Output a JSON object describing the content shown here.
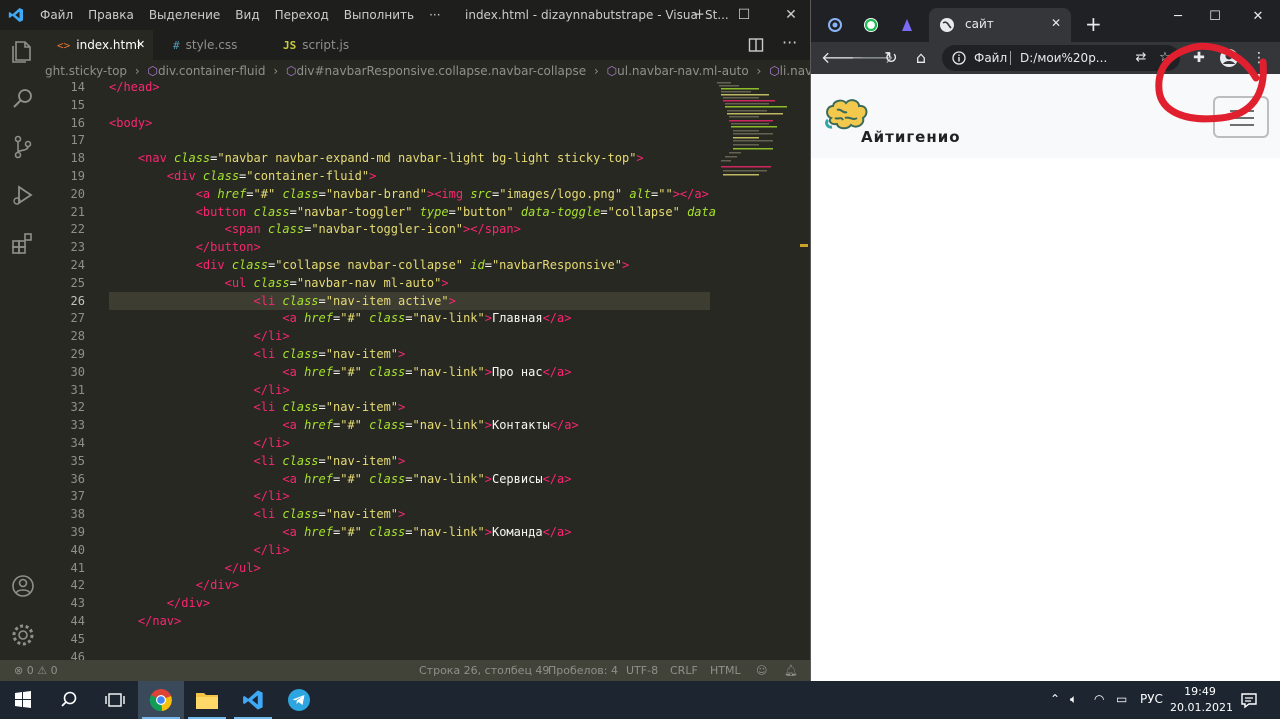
{
  "vscode": {
    "menu": [
      "Файл",
      "Правка",
      "Выделение",
      "Вид",
      "Переход",
      "Выполнить",
      "···"
    ],
    "window_title": "index.html - dizaynnabutstrape - Visual St...",
    "tabs": [
      {
        "icon": "<>",
        "label": "index.html",
        "active": true,
        "close": "✕"
      },
      {
        "icon": "#",
        "label": "style.css",
        "active": false
      },
      {
        "icon": "JS",
        "label": "script.js",
        "active": false
      }
    ],
    "breadcrumb": [
      "ght.sticky-top",
      "div.container-fluid",
      "div#navbarResponsive.collapse.navbar-collapse",
      "ul.navbar-nav.ml-auto",
      "li.nav-item.activ"
    ],
    "current_line": 26,
    "lines": [
      {
        "n": "14",
        "c": [
          [
            "</",
            "t"
          ],
          [
            "head",
            "t"
          ],
          [
            ">",
            "t"
          ]
        ]
      },
      {
        "n": "15",
        "c": []
      },
      {
        "n": "16",
        "c": [
          [
            "<body>",
            "t"
          ]
        ]
      },
      {
        "n": "17",
        "c": []
      },
      {
        "n": "18",
        "c": [
          [
            "    ",
            "p"
          ],
          [
            "<nav ",
            "t"
          ],
          [
            "class",
            "a"
          ],
          [
            "=",
            "p"
          ],
          [
            "\"navbar navbar-expand-md navbar-light bg-light sticky-top\"",
            "s"
          ],
          [
            ">",
            "t"
          ]
        ]
      },
      {
        "n": "19",
        "c": [
          [
            "        ",
            "p"
          ],
          [
            "<div ",
            "t"
          ],
          [
            "class",
            "a"
          ],
          [
            "=",
            "p"
          ],
          [
            "\"container-fluid\"",
            "s"
          ],
          [
            ">",
            "t"
          ]
        ]
      },
      {
        "n": "20",
        "c": [
          [
            "            ",
            "p"
          ],
          [
            "<a ",
            "t"
          ],
          [
            "href",
            "a"
          ],
          [
            "=",
            "p"
          ],
          [
            "\"#\"",
            "s"
          ],
          [
            " ",
            "p"
          ],
          [
            "class",
            "a"
          ],
          [
            "=",
            "p"
          ],
          [
            "\"navbar-brand\"",
            "s"
          ],
          [
            ">",
            "t"
          ],
          [
            "<img ",
            "t"
          ],
          [
            "src",
            "a"
          ],
          [
            "=",
            "p"
          ],
          [
            "\"images/logo.png\"",
            "s"
          ],
          [
            " ",
            "p"
          ],
          [
            "alt",
            "a"
          ],
          [
            "=",
            "p"
          ],
          [
            "\"\"",
            "s"
          ],
          [
            "></a>",
            "t"
          ]
        ]
      },
      {
        "n": "21",
        "c": [
          [
            "            ",
            "p"
          ],
          [
            "<button ",
            "t"
          ],
          [
            "class",
            "a"
          ],
          [
            "=",
            "p"
          ],
          [
            "\"navbar-toggler\"",
            "s"
          ],
          [
            " ",
            "p"
          ],
          [
            "type",
            "a"
          ],
          [
            "=",
            "p"
          ],
          [
            "\"button\"",
            "s"
          ],
          [
            " ",
            "p"
          ],
          [
            "data-toggle",
            "a"
          ],
          [
            "=",
            "p"
          ],
          [
            "\"collapse\"",
            "s"
          ],
          [
            " ",
            "p"
          ],
          [
            "data",
            "a"
          ]
        ]
      },
      {
        "n": "22",
        "c": [
          [
            "                ",
            "p"
          ],
          [
            "<span ",
            "t"
          ],
          [
            "class",
            "a"
          ],
          [
            "=",
            "p"
          ],
          [
            "\"navbar-toggler-icon\"",
            "s"
          ],
          [
            "></span>",
            "t"
          ]
        ]
      },
      {
        "n": "23",
        "c": [
          [
            "            ",
            "p"
          ],
          [
            "</button>",
            "t"
          ]
        ]
      },
      {
        "n": "24",
        "c": [
          [
            "            ",
            "p"
          ],
          [
            "<div ",
            "t"
          ],
          [
            "class",
            "a"
          ],
          [
            "=",
            "p"
          ],
          [
            "\"collapse navbar-collapse\"",
            "s"
          ],
          [
            " ",
            "p"
          ],
          [
            "id",
            "a"
          ],
          [
            "=",
            "p"
          ],
          [
            "\"navbarResponsive\"",
            "s"
          ],
          [
            ">",
            "t"
          ]
        ]
      },
      {
        "n": "25",
        "c": [
          [
            "                ",
            "p"
          ],
          [
            "<ul ",
            "t"
          ],
          [
            "class",
            "a"
          ],
          [
            "=",
            "p"
          ],
          [
            "\"navbar-nav ml-auto\"",
            "s"
          ],
          [
            ">",
            "t"
          ]
        ]
      },
      {
        "n": "26",
        "c": [
          [
            "                    ",
            "p"
          ],
          [
            "<li ",
            "t"
          ],
          [
            "class",
            "a"
          ],
          [
            "=",
            "p"
          ],
          [
            "\"nav-item active\"",
            "s"
          ],
          [
            ">",
            "t"
          ]
        ]
      },
      {
        "n": "27",
        "c": [
          [
            "                        ",
            "p"
          ],
          [
            "<a ",
            "t"
          ],
          [
            "href",
            "a"
          ],
          [
            "=",
            "p"
          ],
          [
            "\"#\"",
            "s"
          ],
          [
            " ",
            "p"
          ],
          [
            "class",
            "a"
          ],
          [
            "=",
            "p"
          ],
          [
            "\"nav-link\"",
            "s"
          ],
          [
            ">",
            "t"
          ],
          [
            "Главная",
            "p"
          ],
          [
            "</a>",
            "t"
          ]
        ]
      },
      {
        "n": "28",
        "c": [
          [
            "                    ",
            "p"
          ],
          [
            "</li>",
            "t"
          ]
        ]
      },
      {
        "n": "29",
        "c": [
          [
            "                    ",
            "p"
          ],
          [
            "<li ",
            "t"
          ],
          [
            "class",
            "a"
          ],
          [
            "=",
            "p"
          ],
          [
            "\"nav-item\"",
            "s"
          ],
          [
            ">",
            "t"
          ]
        ]
      },
      {
        "n": "30",
        "c": [
          [
            "                        ",
            "p"
          ],
          [
            "<a ",
            "t"
          ],
          [
            "href",
            "a"
          ],
          [
            "=",
            "p"
          ],
          [
            "\"#\"",
            "s"
          ],
          [
            " ",
            "p"
          ],
          [
            "class",
            "a"
          ],
          [
            "=",
            "p"
          ],
          [
            "\"nav-link\"",
            "s"
          ],
          [
            ">",
            "t"
          ],
          [
            "Про нас",
            "p"
          ],
          [
            "</a>",
            "t"
          ]
        ]
      },
      {
        "n": "31",
        "c": [
          [
            "                    ",
            "p"
          ],
          [
            "</li>",
            "t"
          ]
        ]
      },
      {
        "n": "32",
        "c": [
          [
            "                    ",
            "p"
          ],
          [
            "<li ",
            "t"
          ],
          [
            "class",
            "a"
          ],
          [
            "=",
            "p"
          ],
          [
            "\"nav-item\"",
            "s"
          ],
          [
            ">",
            "t"
          ]
        ]
      },
      {
        "n": "33",
        "c": [
          [
            "                        ",
            "p"
          ],
          [
            "<a ",
            "t"
          ],
          [
            "href",
            "a"
          ],
          [
            "=",
            "p"
          ],
          [
            "\"#\"",
            "s"
          ],
          [
            " ",
            "p"
          ],
          [
            "class",
            "a"
          ],
          [
            "=",
            "p"
          ],
          [
            "\"nav-link\"",
            "s"
          ],
          [
            ">",
            "t"
          ],
          [
            "Контакты",
            "p"
          ],
          [
            "</a>",
            "t"
          ]
        ]
      },
      {
        "n": "34",
        "c": [
          [
            "                    ",
            "p"
          ],
          [
            "</li>",
            "t"
          ]
        ]
      },
      {
        "n": "35",
        "c": [
          [
            "                    ",
            "p"
          ],
          [
            "<li ",
            "t"
          ],
          [
            "class",
            "a"
          ],
          [
            "=",
            "p"
          ],
          [
            "\"nav-item\"",
            "s"
          ],
          [
            ">",
            "t"
          ]
        ]
      },
      {
        "n": "36",
        "c": [
          [
            "                        ",
            "p"
          ],
          [
            "<a ",
            "t"
          ],
          [
            "href",
            "a"
          ],
          [
            "=",
            "p"
          ],
          [
            "\"#\"",
            "s"
          ],
          [
            " ",
            "p"
          ],
          [
            "class",
            "a"
          ],
          [
            "=",
            "p"
          ],
          [
            "\"nav-link\"",
            "s"
          ],
          [
            ">",
            "t"
          ],
          [
            "Сервисы",
            "p"
          ],
          [
            "</a>",
            "t"
          ]
        ]
      },
      {
        "n": "37",
        "c": [
          [
            "                    ",
            "p"
          ],
          [
            "</li>",
            "t"
          ]
        ]
      },
      {
        "n": "38",
        "c": [
          [
            "                    ",
            "p"
          ],
          [
            "<li ",
            "t"
          ],
          [
            "class",
            "a"
          ],
          [
            "=",
            "p"
          ],
          [
            "\"nav-item\"",
            "s"
          ],
          [
            ">",
            "t"
          ]
        ]
      },
      {
        "n": "39",
        "c": [
          [
            "                        ",
            "p"
          ],
          [
            "<a ",
            "t"
          ],
          [
            "href",
            "a"
          ],
          [
            "=",
            "p"
          ],
          [
            "\"#\"",
            "s"
          ],
          [
            " ",
            "p"
          ],
          [
            "class",
            "a"
          ],
          [
            "=",
            "p"
          ],
          [
            "\"nav-link\"",
            "s"
          ],
          [
            ">",
            "t"
          ],
          [
            "Команда",
            "p"
          ],
          [
            "</a>",
            "t"
          ]
        ]
      },
      {
        "n": "40",
        "c": [
          [
            "                    ",
            "p"
          ],
          [
            "</li>",
            "t"
          ]
        ]
      },
      {
        "n": "41",
        "c": [
          [
            "                ",
            "p"
          ],
          [
            "</ul>",
            "t"
          ]
        ]
      },
      {
        "n": "42",
        "c": [
          [
            "            ",
            "p"
          ],
          [
            "</div>",
            "t"
          ]
        ]
      },
      {
        "n": "43",
        "c": [
          [
            "        ",
            "p"
          ],
          [
            "</div>",
            "t"
          ]
        ]
      },
      {
        "n": "44",
        "c": [
          [
            "    ",
            "p"
          ],
          [
            "</nav>",
            "t"
          ]
        ]
      },
      {
        "n": "45",
        "c": []
      },
      {
        "n": "46",
        "c": []
      }
    ],
    "status": {
      "errors": "⊗ 0 ⚠ 0",
      "position": "Строка 26, столбец 49",
      "spaces": "Пробелов: 4",
      "encoding": "UTF-8",
      "eol": "CRLF",
      "language": "HTML"
    }
  },
  "chrome": {
    "active_tab_title": "сайт",
    "tab_close": "✕",
    "new_tab": "+",
    "scheme_label": "Файл",
    "url": "D:/мои%20р...",
    "site": {
      "brand": "Айтигенио"
    }
  },
  "taskbar": {
    "language": "РУС",
    "time": "19:49",
    "date": "20.01.2021"
  },
  "colors": {
    "editor_bg": "#272822",
    "tag": "#f92672",
    "attr": "#a6e22e",
    "string": "#e6db74",
    "annotation_red": "#e0202e"
  }
}
